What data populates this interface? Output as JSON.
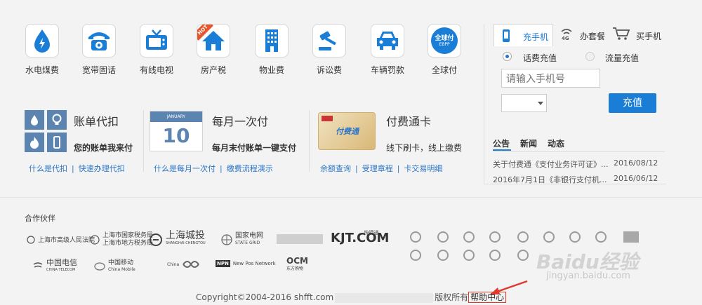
{
  "services": [
    {
      "label": "水电煤费",
      "icon": "water-drop-icon"
    },
    {
      "label": "宽带固话",
      "icon": "telephone-icon"
    },
    {
      "label": "有线电视",
      "icon": "tv-icon"
    },
    {
      "label": "房产税",
      "icon": "house-icon",
      "badge": "HOT"
    },
    {
      "label": "物业费",
      "icon": "building-icon"
    },
    {
      "label": "诉讼费",
      "icon": "gavel-icon"
    },
    {
      "label": "车辆罚款",
      "icon": "car-icon"
    },
    {
      "label": "全球付",
      "icon": "globalpay-icon",
      "logo_text": "全球付",
      "logo_sub": "EBPP"
    }
  ],
  "features": [
    {
      "title": "账单代扣",
      "subtitle": "您的账单我来付",
      "links": [
        "什么是代扣",
        "快速办理代扣"
      ]
    },
    {
      "title": "每月一次付",
      "subtitle": "每月末付账单一键支付",
      "calendar_month": "JANUARY",
      "calendar_day": "10",
      "links": [
        "什么是每月一次付",
        "缴费流程演示"
      ]
    },
    {
      "title": "付费通卡",
      "subtitle": "线下刷卡，线上缴费",
      "card_text": "付费通",
      "links": [
        "余额查询",
        "受理章程",
        "卡交易明细"
      ]
    }
  ],
  "recharge": {
    "tabs": [
      "充手机",
      "办套餐",
      "买手机"
    ],
    "tab_badge": "4G",
    "options": [
      "话费充值",
      "流量充值"
    ],
    "phone_placeholder": "请输入手机号",
    "button": "充值"
  },
  "news": {
    "tabs": [
      "公告",
      "新闻",
      "动态"
    ],
    "items": [
      {
        "title": "关于付费通《支付业务许可证》...",
        "date": "2016/08/12"
      },
      {
        "title": "2016年7月1日《非银行支付机...",
        "date": "2016/06/12"
      }
    ]
  },
  "partners": {
    "title": "合作伙伴",
    "row1": [
      "上海市高级人民法院",
      "上海市国家税务局",
      "上海市地方税务局",
      "上海城投",
      "SHANGHAI CHENGTOU",
      "国家电网",
      "STATE GRID",
      "KJT.COM",
      "快捷通"
    ],
    "row2": [
      "中国电信",
      "CHINA TELECOM",
      "中国移动",
      "China Mobile",
      "China",
      "New Pos Network",
      "OCM",
      "东方购物"
    ]
  },
  "footer": {
    "copyright": "Copyright©2004-2016 shfft.com",
    "rights": "版权所有",
    "help": "帮助中心"
  },
  "watermark": {
    "brand": "Baidu经验",
    "url": "jingyan.baidu.com"
  },
  "colors": {
    "accent": "#1b7ed6",
    "link": "#2a75c8",
    "hot": "#e8542b",
    "annotation": "#e03a2d"
  }
}
